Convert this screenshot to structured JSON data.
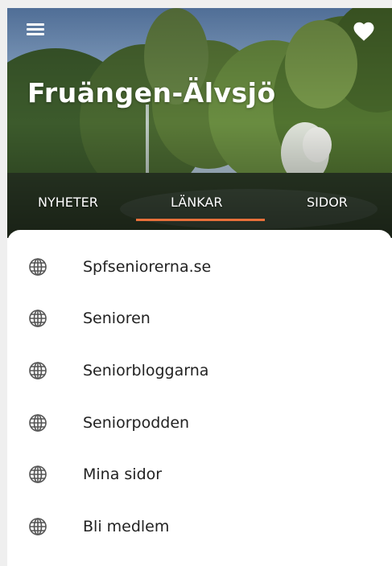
{
  "header": {
    "title": "Fruängen-Älvsjö",
    "menu_icon": "hamburger-menu-icon",
    "favorite_icon": "heart-icon"
  },
  "tabs": [
    {
      "label": "NYHETER",
      "active": false
    },
    {
      "label": "LÄNKAR",
      "active": true
    },
    {
      "label": "SIDOR",
      "active": false
    }
  ],
  "links": [
    {
      "label": "Spfseniorerna.se",
      "icon": "globe-icon"
    },
    {
      "label": "Senioren",
      "icon": "globe-icon"
    },
    {
      "label": "Seniorbloggarna",
      "icon": "globe-icon"
    },
    {
      "label": "Seniorpodden",
      "icon": "globe-icon"
    },
    {
      "label": "Mina sidor",
      "icon": "globe-icon"
    },
    {
      "label": "Bli medlem",
      "icon": "globe-icon"
    }
  ],
  "colors": {
    "accent": "#e8703a",
    "text": "#222222",
    "icon": "#555555"
  }
}
